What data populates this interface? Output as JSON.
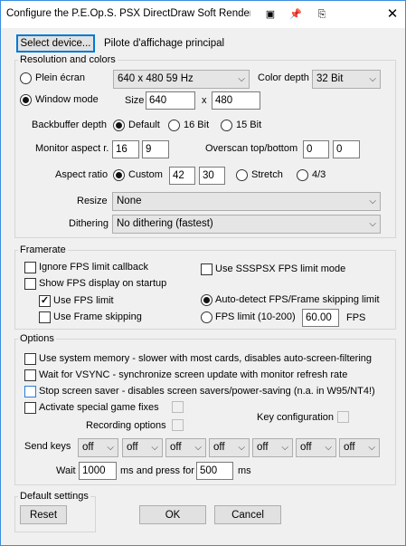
{
  "title": "Configure the P.E.Op.S. PSX DirectDraw Soft Render...",
  "select_device": "Select device...",
  "device_name": "Pilote d'affichage principal",
  "resolution": {
    "group_label": "Resolution and colors",
    "fullscreen_label": "Plein écran",
    "fullscreen_mode": "640 x 480  59 Hz",
    "color_depth_label": "Color depth",
    "color_depth": "32 Bit",
    "window_mode_label": "Window mode",
    "size_label": "Size",
    "width": "640",
    "x_label": "x",
    "height": "480",
    "backbuffer_label": "Backbuffer depth",
    "bb_default": "Default",
    "bb_16": "16 Bit",
    "bb_15": "15 Bit",
    "monitor_aspect_label": "Monitor aspect r.",
    "monitor_aspect_w": "16",
    "monitor_aspect_h": "9",
    "overscan_label": "Overscan top/bottom",
    "overscan_top": "0",
    "overscan_bottom": "0",
    "aspect_ratio_label": "Aspect ratio",
    "ar_custom": "Custom",
    "ar_custom_w": "42",
    "ar_custom_h": "30",
    "ar_stretch": "Stretch",
    "ar_43": "4/3",
    "resize_label": "Resize",
    "resize_value": "None",
    "dithering_label": "Dithering",
    "dithering_value": "No dithering (fastest)"
  },
  "framerate": {
    "group_label": "Framerate",
    "ignore_fps": "Ignore FPS limit callback",
    "use_ssspsx": "Use SSSPSX FPS limit mode",
    "show_fps": "Show FPS display on startup",
    "use_fps_limit": "Use FPS limit",
    "use_fps_limit_checked": "✓",
    "auto_detect": "Auto-detect FPS/Frame skipping limit",
    "use_frame_skip": "Use Frame skipping",
    "fps_limit": "FPS limit (10-200)",
    "fps_value": "60.00",
    "fps_unit": "FPS"
  },
  "options": {
    "group_label": "Options",
    "system_memory": "Use system memory - slower with most cards, disables auto-screen-filtering",
    "vsync": "Wait for VSYNC - synchronize screen update with monitor refresh rate",
    "screensaver": "Stop screen saver - disables screen savers/power-saving (n.a. in W95/NT4!)",
    "special_fixes": "Activate special game fixes",
    "recording": "Recording options",
    "key_config": "Key configuration",
    "send_keys_label": "Send keys",
    "send_keys": [
      "off",
      "off",
      "off",
      "off",
      "off",
      "off",
      "off"
    ],
    "wait_label": "Wait",
    "wait_value": "1000",
    "press_label": "ms and press for",
    "press_value": "500",
    "ms_label": "ms"
  },
  "defaults": {
    "group_label": "Default settings",
    "reset": "Reset"
  },
  "ok": "OK",
  "cancel": "Cancel"
}
